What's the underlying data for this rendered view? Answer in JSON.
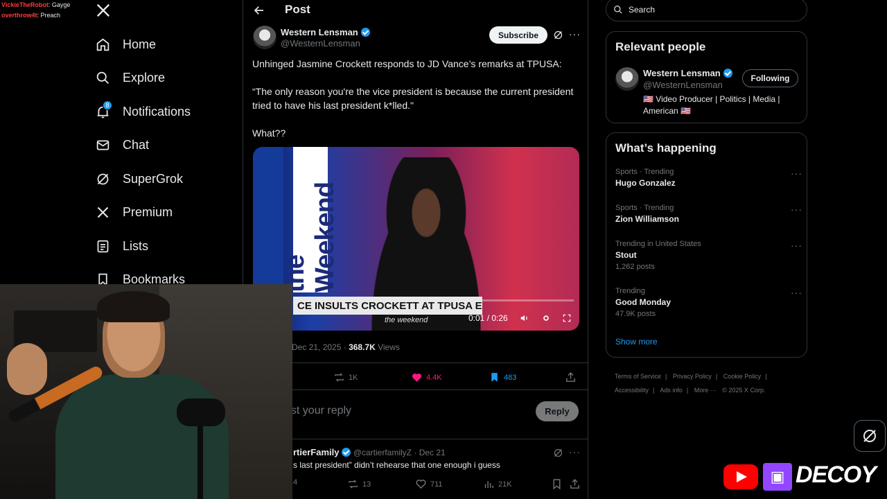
{
  "stream_chat": [
    {
      "user": "VickieTheRobot",
      "message": "Gayge"
    },
    {
      "user": "overthrow4t",
      "message": "Preach"
    }
  ],
  "nav": {
    "items": [
      {
        "key": "home",
        "label": "Home"
      },
      {
        "key": "explore",
        "label": "Explore"
      },
      {
        "key": "notifications",
        "label": "Notifications",
        "badge": "8"
      },
      {
        "key": "chat",
        "label": "Chat"
      },
      {
        "key": "supergrok",
        "label": "SuperGrok"
      },
      {
        "key": "premium",
        "label": "Premium"
      },
      {
        "key": "lists",
        "label": "Lists"
      },
      {
        "key": "bookmarks",
        "label": "Bookmarks"
      }
    ]
  },
  "header": {
    "title": "Post"
  },
  "post": {
    "author_name": "Western Lensman",
    "author_handle": "@WesternLensman",
    "subscribe_label": "Subscribe",
    "text_line1": "Unhinged Jasmine Crockett responds to JD Vance’s remarks at TPUSA:",
    "text_quote": "“The only reason you're the vice president is because the current president tried to have his last president k*lled.\"",
    "text_tail": "What??",
    "video": {
      "brand": "the Weekend",
      "chyron": "CE INSULTS CROCKETT AT TPUSA EVENT",
      "chyron_sub": "the weekend",
      "time": "0:01 / 0:26"
    },
    "date": "Dec 21, 2025",
    "views_count": "368.7K",
    "views_label": " Views",
    "stats": {
      "reposts": "1K",
      "likes": "4.4K",
      "bookmarks": "483"
    },
    "reply_placeholder": "ost your reply",
    "reply_label": "Reply"
  },
  "reply": {
    "author_name": "rtierFamily",
    "author_handle": "@cartierfamilyZ",
    "date": "· Dec 21",
    "text": "s last president” didn’t rehearse that one enough i guess",
    "stats": {
      "replies": "4",
      "reposts": "13",
      "likes": "711",
      "views": "21K"
    }
  },
  "search": {
    "placeholder": "Search"
  },
  "relevant": {
    "title": "Relevant people",
    "name": "Western Lensman",
    "handle": "@WesternLensman",
    "follow_label": "Following",
    "bio_line1": "🇺🇸 Video Producer | Politics | Media |",
    "bio_line2": "American 🇺🇸"
  },
  "happening": {
    "title": "What’s happening",
    "trends": [
      {
        "context": "Sports · Trending",
        "title": "Hugo Gonzalez",
        "count": ""
      },
      {
        "context": "Sports · Trending",
        "title": "Zion Williamson",
        "count": ""
      },
      {
        "context": "Trending in United States",
        "title": "Stout",
        "count": "1,262 posts"
      },
      {
        "context": "Trending",
        "title": "Good Monday",
        "count": "47.9K posts"
      }
    ],
    "show_more": "Show more"
  },
  "footer": {
    "links": [
      "Terms of Service",
      "|",
      "Privacy Policy",
      "|",
      "Cookie Policy",
      "|",
      "Accessibility",
      "|",
      "Ads info",
      "|",
      "More ···",
      "© 2025 X Corp."
    ]
  },
  "overlay": {
    "brand": "DECOY",
    "twitch_glyph": "▣"
  },
  "colors": {
    "accent": "#1d9bf0",
    "like": "#f91880",
    "background": "#000000",
    "border": "#2f3336",
    "muted": "#71767b"
  }
}
